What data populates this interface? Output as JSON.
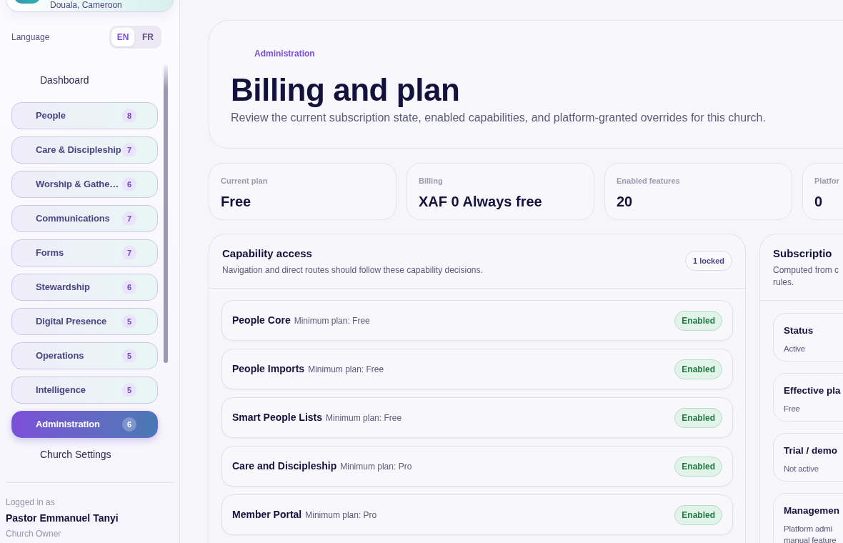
{
  "sidebar": {
    "church": {
      "location": "Douala, Cameroon"
    },
    "language": {
      "label": "Language",
      "options": [
        {
          "label": "EN",
          "selected": true
        },
        {
          "label": "FR",
          "selected": false
        }
      ]
    },
    "nav": [
      {
        "label": "Dashboard",
        "kind": "link",
        "selected": false
      },
      {
        "label": "People",
        "kind": "group",
        "count": "8",
        "selected": false
      },
      {
        "label": "Care & Discipleship",
        "kind": "group",
        "count": "7",
        "selected": false
      },
      {
        "label": "Worship & Gathe…",
        "kind": "group",
        "count": "6",
        "selected": false
      },
      {
        "label": "Communications",
        "kind": "group",
        "count": "7",
        "selected": false
      },
      {
        "label": "Forms",
        "kind": "group",
        "count": "7",
        "selected": false
      },
      {
        "label": "Stewardship",
        "kind": "group",
        "count": "6",
        "selected": false
      },
      {
        "label": "Digital Presence",
        "kind": "group",
        "count": "5",
        "selected": false
      },
      {
        "label": "Operations",
        "kind": "group",
        "count": "5",
        "selected": false
      },
      {
        "label": "Intelligence",
        "kind": "group",
        "count": "5",
        "selected": false
      },
      {
        "label": "Administration",
        "kind": "group",
        "count": "6",
        "selected": true
      },
      {
        "label": "Church Settings",
        "kind": "link",
        "selected": false
      }
    ],
    "user": {
      "caption": "Logged in as",
      "name": "Pastor Emmanuel Tanyi",
      "role": "Church Owner"
    }
  },
  "header": {
    "eyebrow": "Administration",
    "title": "Billing and plan",
    "subtitle": "Review the current subscription state, enabled capabilities, and platform-granted overrides for this church."
  },
  "stats": [
    {
      "label": "Current plan",
      "value": "Free"
    },
    {
      "label": "Billing",
      "value": "XAF 0 Always free"
    },
    {
      "label": "Enabled features",
      "value": "20"
    },
    {
      "label": "Platfor",
      "value": "0"
    }
  ],
  "capabilities": {
    "title": "Capability access",
    "subtitle": "Navigation and direct routes should follow these capability decisions.",
    "badge": "1 locked",
    "rows": [
      {
        "name": "People Core",
        "plan": "Minimum plan: Free",
        "status": "Enabled",
        "enabled": true
      },
      {
        "name": "People Imports",
        "plan": "Minimum plan: Free",
        "status": "Enabled",
        "enabled": true
      },
      {
        "name": "Smart People Lists",
        "plan": "Minimum plan: Free",
        "status": "Enabled",
        "enabled": true
      },
      {
        "name": "Care and Discipleship",
        "plan": "Minimum plan: Pro",
        "status": "Enabled",
        "enabled": true
      },
      {
        "name": "Member Portal",
        "plan": "Minimum plan: Pro",
        "status": "Enabled",
        "enabled": true
      }
    ]
  },
  "subscription": {
    "title": "Subscriptio",
    "subtitle_lines": [
      "Computed from c",
      "rules."
    ],
    "items": [
      {
        "title": "Status",
        "lines": [
          "Active"
        ]
      },
      {
        "title": "Effective pla",
        "lines": [
          "Free"
        ]
      },
      {
        "title": "Trial / demo",
        "lines": [
          "Not active"
        ]
      },
      {
        "title": "Managemen",
        "lines": [
          "Platform admi",
          "manual feature"
        ]
      }
    ]
  }
}
